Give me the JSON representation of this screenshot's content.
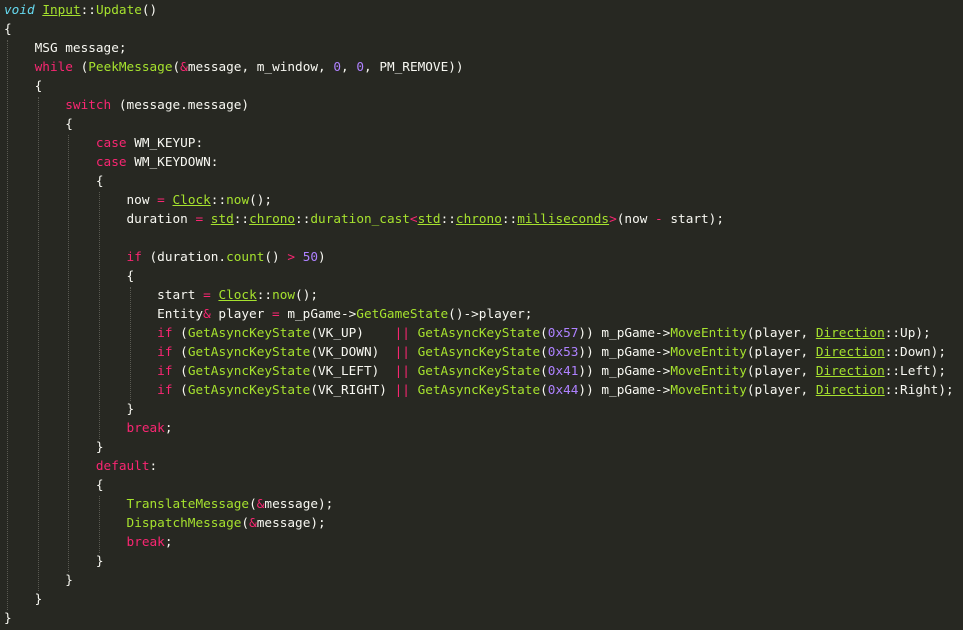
{
  "editor": {
    "language": "cpp",
    "theme_colors": {
      "background": "#272822",
      "plain": "#f8f8f2",
      "keyword": "#f92672",
      "type": "#66d9ef",
      "function": "#a6e22e",
      "number": "#ae81ff"
    },
    "lines": [
      [
        [
          "ty",
          "void"
        ],
        [
          "pl",
          " "
        ],
        [
          "cls",
          "Input"
        ],
        [
          "pl",
          "::"
        ],
        [
          "fn",
          "Update"
        ],
        [
          "pl",
          "()"
        ]
      ],
      [
        [
          "pl",
          "{"
        ]
      ],
      [
        [
          "pl",
          "    MSG message;"
        ]
      ],
      [
        [
          "pl",
          "    "
        ],
        [
          "kw",
          "while"
        ],
        [
          "pl",
          " ("
        ],
        [
          "fn",
          "PeekMessage"
        ],
        [
          "pl",
          "("
        ],
        [
          "op",
          "&"
        ],
        [
          "pl",
          "message, m_window, "
        ],
        [
          "nm",
          "0"
        ],
        [
          "pl",
          ", "
        ],
        [
          "nm",
          "0"
        ],
        [
          "pl",
          ", PM_REMOVE))"
        ]
      ],
      [
        [
          "pl",
          "    {"
        ]
      ],
      [
        [
          "pl",
          "        "
        ],
        [
          "kw",
          "switch"
        ],
        [
          "pl",
          " (message.message)"
        ]
      ],
      [
        [
          "pl",
          "        {"
        ]
      ],
      [
        [
          "pl",
          "            "
        ],
        [
          "kw",
          "case"
        ],
        [
          "pl",
          " WM_KEYUP:"
        ]
      ],
      [
        [
          "pl",
          "            "
        ],
        [
          "kw",
          "case"
        ],
        [
          "pl",
          " WM_KEYDOWN:"
        ]
      ],
      [
        [
          "pl",
          "            {"
        ]
      ],
      [
        [
          "pl",
          "                now "
        ],
        [
          "op",
          "="
        ],
        [
          "pl",
          " "
        ],
        [
          "cls",
          "Clock"
        ],
        [
          "pl",
          "::"
        ],
        [
          "fn",
          "now"
        ],
        [
          "pl",
          "();"
        ]
      ],
      [
        [
          "pl",
          "                duration "
        ],
        [
          "op",
          "="
        ],
        [
          "pl",
          " "
        ],
        [
          "cls",
          "std"
        ],
        [
          "pl",
          "::"
        ],
        [
          "cls",
          "chrono"
        ],
        [
          "pl",
          "::"
        ],
        [
          "fn",
          "duration_cast"
        ],
        [
          "op",
          "<"
        ],
        [
          "cls",
          "std"
        ],
        [
          "pl",
          "::"
        ],
        [
          "cls",
          "chrono"
        ],
        [
          "pl",
          "::"
        ],
        [
          "cls",
          "milliseconds"
        ],
        [
          "op",
          ">"
        ],
        [
          "pl",
          "(now "
        ],
        [
          "op",
          "-"
        ],
        [
          "pl",
          " start);"
        ]
      ],
      [
        [
          "pl",
          ""
        ]
      ],
      [
        [
          "pl",
          "                "
        ],
        [
          "kw",
          "if"
        ],
        [
          "pl",
          " (duration."
        ],
        [
          "fn",
          "count"
        ],
        [
          "pl",
          "() "
        ],
        [
          "op",
          ">"
        ],
        [
          "pl",
          " "
        ],
        [
          "nm",
          "50"
        ],
        [
          "pl",
          ")"
        ]
      ],
      [
        [
          "pl",
          "                {"
        ]
      ],
      [
        [
          "pl",
          "                    start "
        ],
        [
          "op",
          "="
        ],
        [
          "pl",
          " "
        ],
        [
          "cls",
          "Clock"
        ],
        [
          "pl",
          "::"
        ],
        [
          "fn",
          "now"
        ],
        [
          "pl",
          "();"
        ]
      ],
      [
        [
          "pl",
          "                    Entity"
        ],
        [
          "op",
          "&"
        ],
        [
          "pl",
          " player "
        ],
        [
          "op",
          "="
        ],
        [
          "pl",
          " m_pGame->"
        ],
        [
          "fn",
          "GetGameState"
        ],
        [
          "pl",
          "()->player;"
        ]
      ],
      [
        [
          "pl",
          "                    "
        ],
        [
          "kw",
          "if"
        ],
        [
          "pl",
          " ("
        ],
        [
          "fn",
          "GetAsyncKeyState"
        ],
        [
          "pl",
          "(VK_UP)    "
        ],
        [
          "op",
          "||"
        ],
        [
          "pl",
          " "
        ],
        [
          "fn",
          "GetAsyncKeyState"
        ],
        [
          "pl",
          "("
        ],
        [
          "nm",
          "0x57"
        ],
        [
          "pl",
          ")) m_pGame->"
        ],
        [
          "fn",
          "MoveEntity"
        ],
        [
          "pl",
          "(player, "
        ],
        [
          "cls",
          "Direction"
        ],
        [
          "pl",
          "::Up);"
        ]
      ],
      [
        [
          "pl",
          "                    "
        ],
        [
          "kw",
          "if"
        ],
        [
          "pl",
          " ("
        ],
        [
          "fn",
          "GetAsyncKeyState"
        ],
        [
          "pl",
          "(VK_DOWN)  "
        ],
        [
          "op",
          "||"
        ],
        [
          "pl",
          " "
        ],
        [
          "fn",
          "GetAsyncKeyState"
        ],
        [
          "pl",
          "("
        ],
        [
          "nm",
          "0x53"
        ],
        [
          "pl",
          ")) m_pGame->"
        ],
        [
          "fn",
          "MoveEntity"
        ],
        [
          "pl",
          "(player, "
        ],
        [
          "cls",
          "Direction"
        ],
        [
          "pl",
          "::Down);"
        ]
      ],
      [
        [
          "pl",
          "                    "
        ],
        [
          "kw",
          "if"
        ],
        [
          "pl",
          " ("
        ],
        [
          "fn",
          "GetAsyncKeyState"
        ],
        [
          "pl",
          "(VK_LEFT)  "
        ],
        [
          "op",
          "||"
        ],
        [
          "pl",
          " "
        ],
        [
          "fn",
          "GetAsyncKeyState"
        ],
        [
          "pl",
          "("
        ],
        [
          "nm",
          "0x41"
        ],
        [
          "pl",
          ")) m_pGame->"
        ],
        [
          "fn",
          "MoveEntity"
        ],
        [
          "pl",
          "(player, "
        ],
        [
          "cls",
          "Direction"
        ],
        [
          "pl",
          "::Left);"
        ]
      ],
      [
        [
          "pl",
          "                    "
        ],
        [
          "kw",
          "if"
        ],
        [
          "pl",
          " ("
        ],
        [
          "fn",
          "GetAsyncKeyState"
        ],
        [
          "pl",
          "(VK_RIGHT) "
        ],
        [
          "op",
          "||"
        ],
        [
          "pl",
          " "
        ],
        [
          "fn",
          "GetAsyncKeyState"
        ],
        [
          "pl",
          "("
        ],
        [
          "nm",
          "0x44"
        ],
        [
          "pl",
          ")) m_pGame->"
        ],
        [
          "fn",
          "MoveEntity"
        ],
        [
          "pl",
          "(player, "
        ],
        [
          "cls",
          "Direction"
        ],
        [
          "pl",
          "::Right);"
        ]
      ],
      [
        [
          "pl",
          "                }"
        ]
      ],
      [
        [
          "pl",
          "                "
        ],
        [
          "kw",
          "break"
        ],
        [
          "pl",
          ";"
        ]
      ],
      [
        [
          "pl",
          "            }"
        ]
      ],
      [
        [
          "pl",
          "            "
        ],
        [
          "kw",
          "default"
        ],
        [
          "pl",
          ":"
        ]
      ],
      [
        [
          "pl",
          "            {"
        ]
      ],
      [
        [
          "pl",
          "                "
        ],
        [
          "fn",
          "TranslateMessage"
        ],
        [
          "pl",
          "("
        ],
        [
          "op",
          "&"
        ],
        [
          "pl",
          "message);"
        ]
      ],
      [
        [
          "pl",
          "                "
        ],
        [
          "fn",
          "DispatchMessage"
        ],
        [
          "pl",
          "("
        ],
        [
          "op",
          "&"
        ],
        [
          "pl",
          "message);"
        ]
      ],
      [
        [
          "pl",
          "                "
        ],
        [
          "kw",
          "break"
        ],
        [
          "pl",
          ";"
        ]
      ],
      [
        [
          "pl",
          "            }"
        ]
      ],
      [
        [
          "pl",
          "        }"
        ]
      ],
      [
        [
          "pl",
          "    }"
        ]
      ],
      [
        [
          "pl",
          "}"
        ]
      ]
    ]
  }
}
